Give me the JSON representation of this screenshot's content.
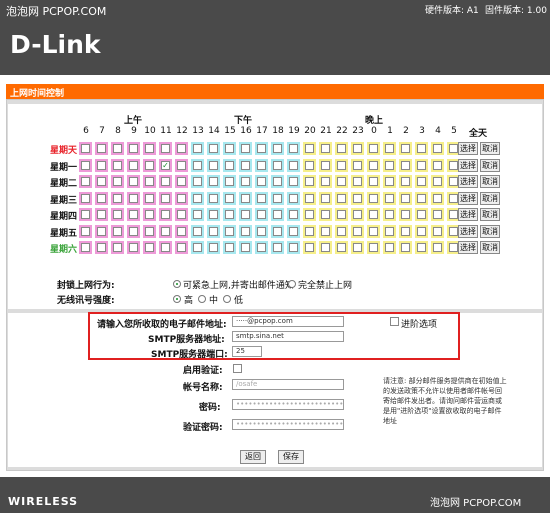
{
  "watermark_top": "泡泡网 PCPOP.COM",
  "hardware_version": "硬件版本: A1",
  "firmware_version": "固件版本: 1.00",
  "logo": "D-Link",
  "section_title": "上网时间控制",
  "periods": {
    "am": "上午",
    "pm": "下午",
    "night": "晚上",
    "allday": "全天"
  },
  "hours": [
    "6",
    "7",
    "8",
    "9",
    "10",
    "11",
    "12",
    "13",
    "14",
    "15",
    "16",
    "17",
    "18",
    "19",
    "20",
    "21",
    "22",
    "23",
    "0",
    "1",
    "2",
    "3",
    "4",
    "5"
  ],
  "days": [
    {
      "label": "星期天",
      "color": "#e8232a"
    },
    {
      "label": "星期一",
      "color": "#111111"
    },
    {
      "label": "星期二",
      "color": "#111111"
    },
    {
      "label": "星期三",
      "color": "#111111"
    },
    {
      "label": "星期四",
      "color": "#111111"
    },
    {
      "label": "星期五",
      "color": "#111111"
    },
    {
      "label": "星期六",
      "color": "#3aa33a"
    }
  ],
  "checked_cells": [
    {
      "day": "星期一",
      "hour": "11"
    }
  ],
  "select_label": "选择",
  "cancel_label": "取消",
  "block_behavior": {
    "label": "封锁上网行为:",
    "options": [
      "可紧急上网,并寄出邮件通知",
      "完全禁止上网"
    ],
    "selected": "可紧急上网,并寄出邮件通知"
  },
  "signal_strength": {
    "label": "无线讯号强度:",
    "options": [
      "高",
      "中",
      "低"
    ],
    "selected": "高"
  },
  "email": {
    "label": "请输入您所收取的电子邮件地址:",
    "value": "·····@pcpop.com"
  },
  "advanced": {
    "label": "进阶选项",
    "checked": false
  },
  "smtp_server": {
    "label": "SMTP服务器地址:",
    "value": "smtp.sina.net"
  },
  "smtp_port": {
    "label": "SMTP服务器端口:",
    "value": "25"
  },
  "enable_auth": {
    "label": "启用验证:",
    "checked": false
  },
  "account": {
    "label": "帐号名称:",
    "value": "/osafe"
  },
  "password": {
    "label": "密码:",
    "value": "••••••••••••••••••••••••••••••••"
  },
  "confirm_password": {
    "label": "验证密码:",
    "value": "••••••••••••••••••••••••••••••••"
  },
  "note": "请注意: 部分邮件服务提供商在初始值上的发送政策不允许以使用者邮件帐号回寄给邮件发出者。请询问邮件营运商或是用\"进阶选项\"设置欲收取的电子邮件地址",
  "buttons": {
    "back": "返回",
    "save": "保存"
  },
  "footer_brand": "WIRELESS",
  "watermark_bottom": "泡泡网 PCPOP.COM",
  "colors": {
    "morning": "#ee9ad8",
    "afternoon": "#a7e8ef",
    "night": "#f6ef8a",
    "header": "#ff6a00",
    "highlight": "#e02020"
  }
}
